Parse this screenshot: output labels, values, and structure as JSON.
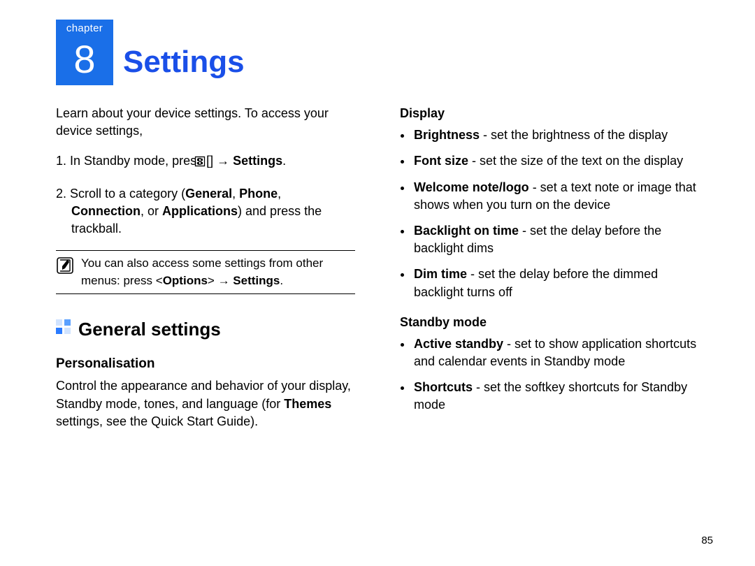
{
  "chapter": {
    "label": "chapter",
    "number": "8",
    "title": "Settings"
  },
  "left": {
    "intro": "Learn about your device settings. To access your device settings,",
    "step1_prefix": "1. In Standby mode, press [",
    "step1_arrow": "→",
    "step1_bold": "Settings",
    "step1_suffix": ".",
    "step2_prefix": "2. Scroll to a category (",
    "step2_b1": "General",
    "step2_c1": ", ",
    "step2_b2": "Phone",
    "step2_c2": ", ",
    "step2_b3": "Connection",
    "step2_c3": ", or ",
    "step2_b4": "Applications",
    "step2_suffix": ") and press the trackball.",
    "note_prefix": "You can also access some settings from other menus: press <",
    "note_b1": "Options",
    "note_mid": "> → ",
    "note_b2": "Settings",
    "note_suffix": ".",
    "h2": "General settings",
    "h3": "Personalisation",
    "para_prefix": "Control the appearance and behavior of your display, Standby mode, tones, and language (for ",
    "para_b": "Themes",
    "para_suffix": " settings, see the Quick Start Guide)."
  },
  "right": {
    "h4a": "Display",
    "bullets_a": [
      {
        "b": "Brightness",
        "rest": " - set the brightness of the display"
      },
      {
        "b": "Font size",
        "rest": " - set the size of the text on the display"
      },
      {
        "b": "Welcome note/logo",
        "rest": " - set a text note or image that shows when you turn on the device"
      },
      {
        "b": "Backlight on time",
        "rest": " - set the delay before the backlight dims"
      },
      {
        "b": "Dim time",
        "rest": " - set the delay before the dimmed backlight turns off"
      }
    ],
    "h4b": "Standby mode",
    "bullets_b": [
      {
        "b": "Active standby",
        "rest": " - set to show application shortcuts and calendar events in Standby mode"
      },
      {
        "b": "Shortcuts",
        "rest": " - set the softkey shortcuts for Standby mode"
      }
    ]
  },
  "page_number": "85"
}
